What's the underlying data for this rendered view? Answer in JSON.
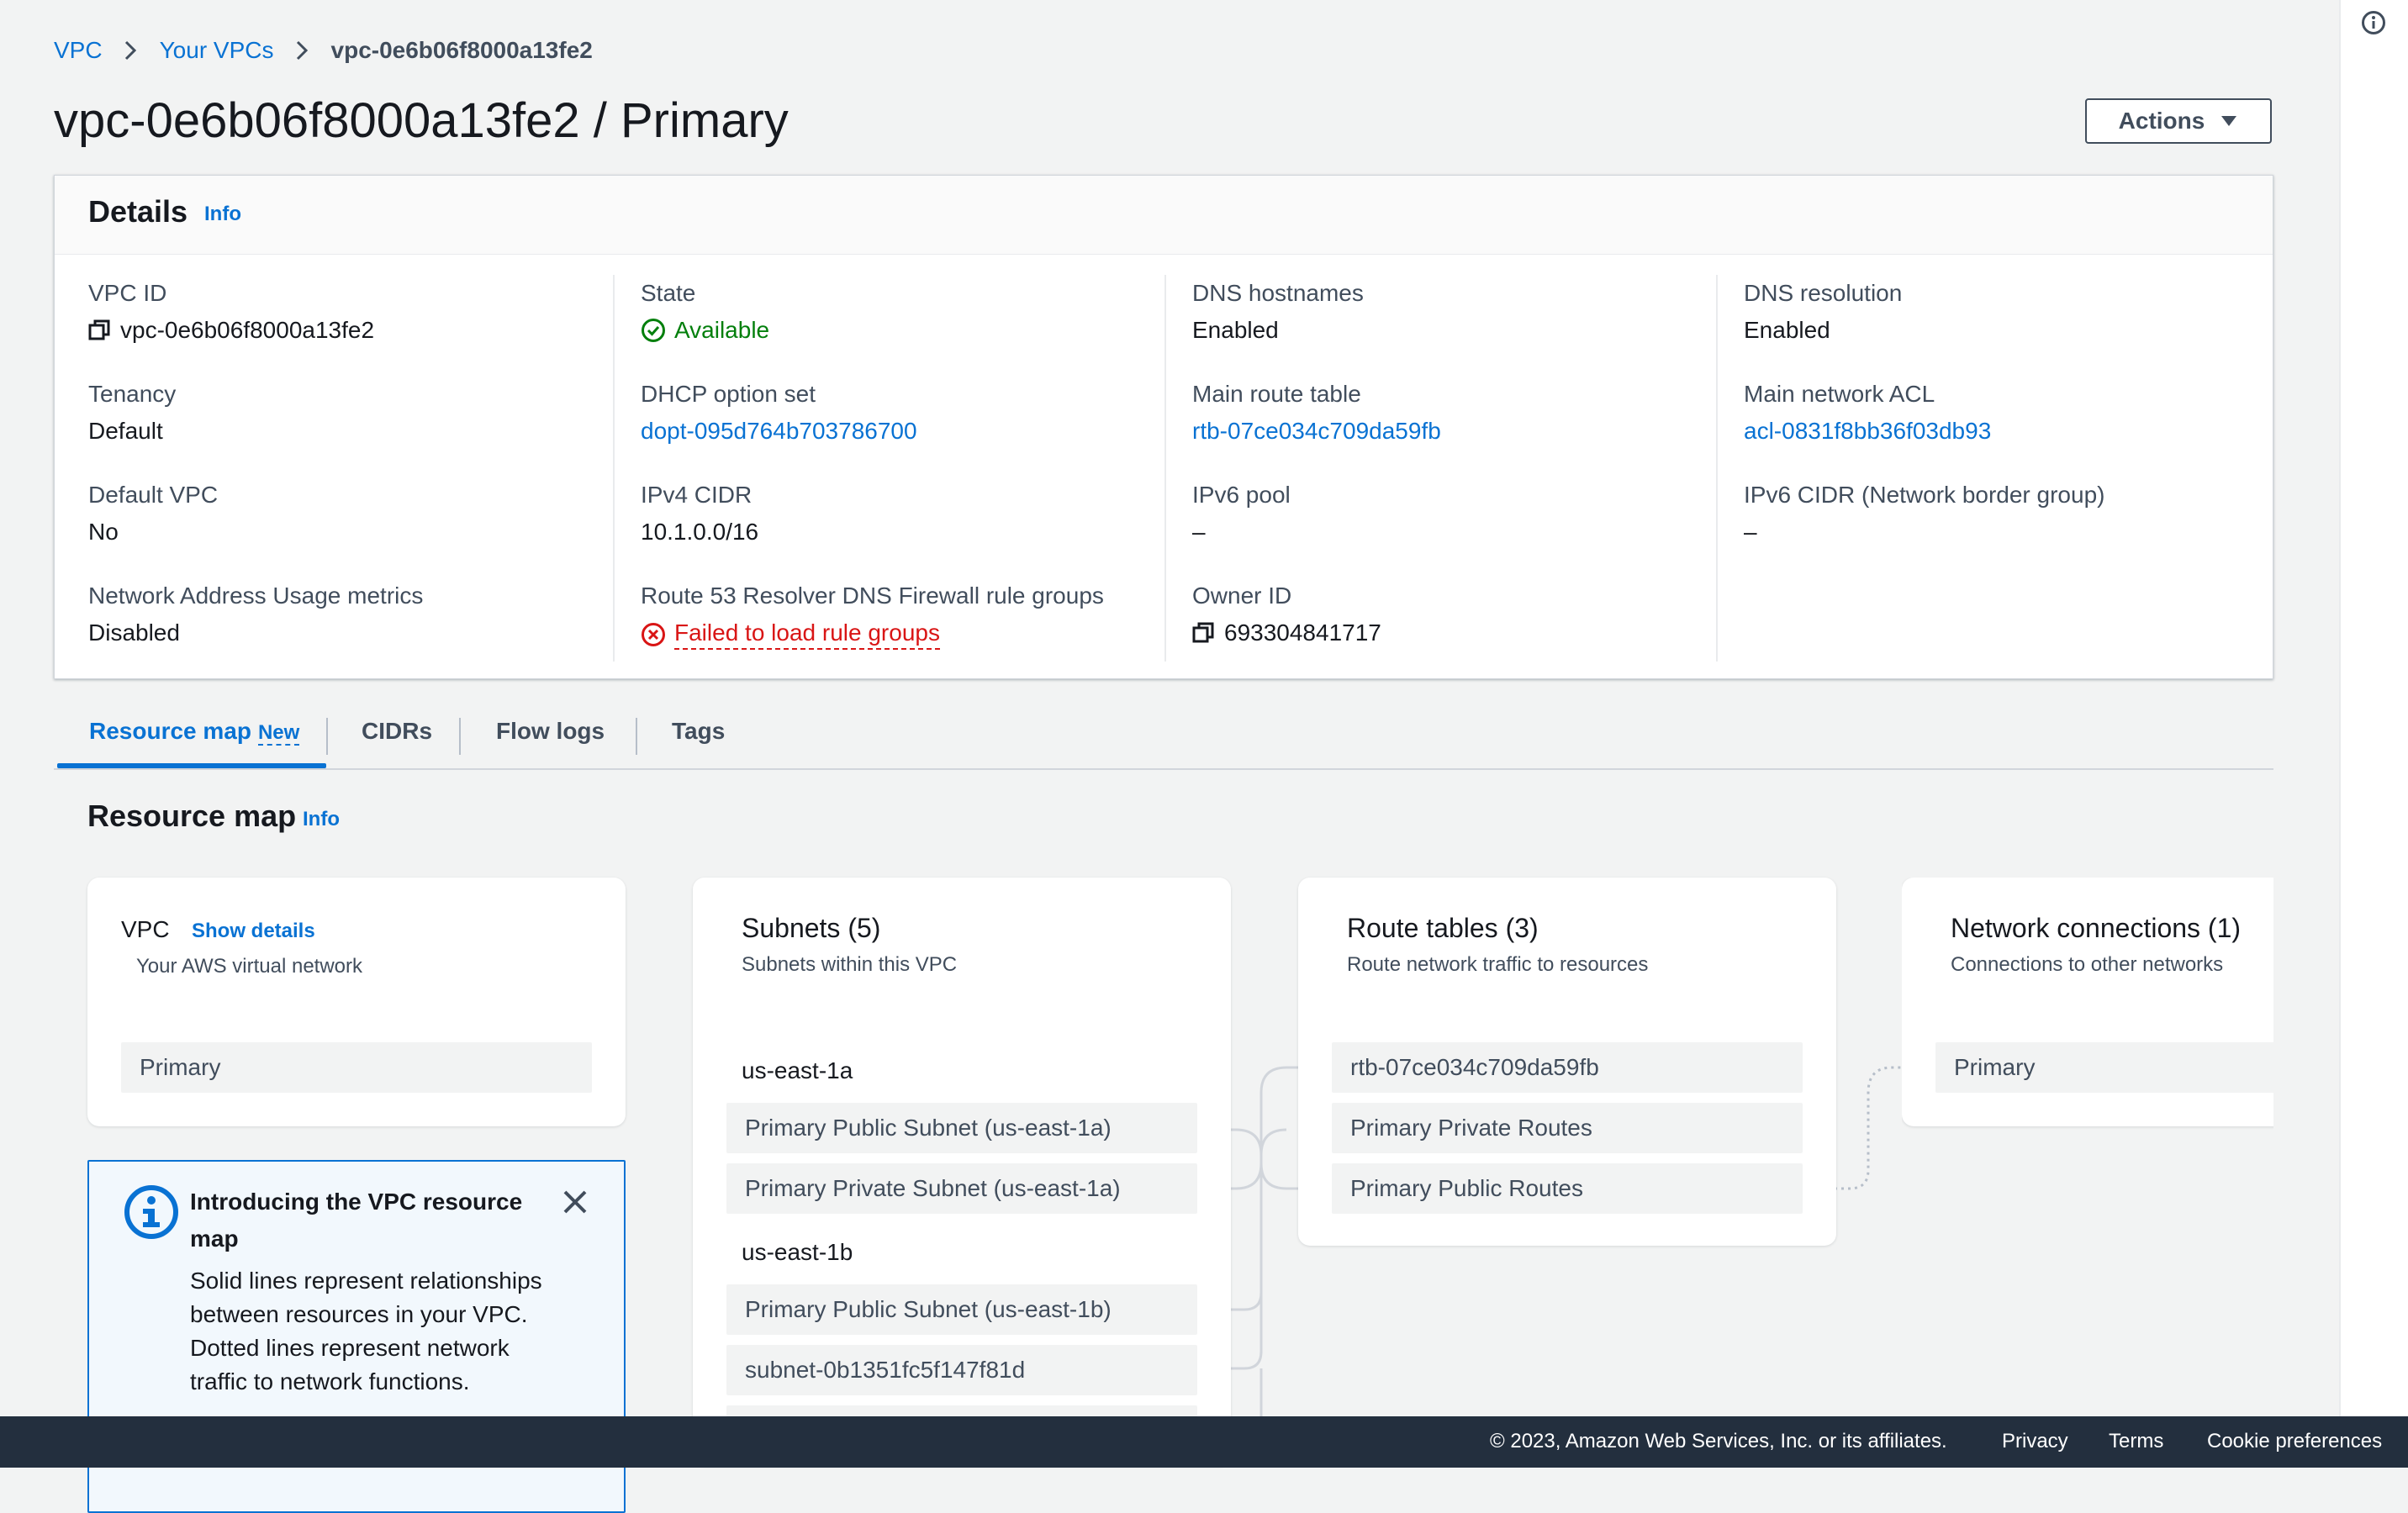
{
  "breadcrumb": {
    "items": [
      "VPC",
      "Your VPCs"
    ],
    "current": "vpc-0e6b06f8000a13fe2"
  },
  "page": {
    "title": "vpc-0e6b06f8000a13fe2 / Primary",
    "actions_label": "Actions"
  },
  "details": {
    "title": "Details",
    "info": "Info",
    "fields": {
      "vpc_id": {
        "label": "VPC ID",
        "value": "vpc-0e6b06f8000a13fe2"
      },
      "state": {
        "label": "State",
        "value": "Available"
      },
      "dns_hostnames": {
        "label": "DNS hostnames",
        "value": "Enabled"
      },
      "dns_resolution": {
        "label": "DNS resolution",
        "value": "Enabled"
      },
      "tenancy": {
        "label": "Tenancy",
        "value": "Default"
      },
      "dhcp": {
        "label": "DHCP option set",
        "value": "dopt-095d764b703786700"
      },
      "main_route_table": {
        "label": "Main route table",
        "value": "rtb-07ce034c709da59fb"
      },
      "main_acl": {
        "label": "Main network ACL",
        "value": "acl-0831f8bb36f03db93"
      },
      "default_vpc": {
        "label": "Default VPC",
        "value": "No"
      },
      "ipv4_cidr": {
        "label": "IPv4 CIDR",
        "value": "10.1.0.0/16"
      },
      "ipv6_pool": {
        "label": "IPv6 pool",
        "value": "–"
      },
      "ipv6_cidr": {
        "label": "IPv6 CIDR (Network border group)",
        "value": "–"
      },
      "nau_metrics": {
        "label": "Network Address Usage metrics",
        "value": "Disabled"
      },
      "route53": {
        "label": "Route 53 Resolver DNS Firewall rule groups",
        "value": "Failed to load rule groups"
      },
      "owner_id": {
        "label": "Owner ID",
        "value": "693304841717"
      }
    }
  },
  "tabs": [
    {
      "label": "Resource map",
      "badge": "New",
      "active": true
    },
    {
      "label": "CIDRs"
    },
    {
      "label": "Flow logs"
    },
    {
      "label": "Tags"
    }
  ],
  "resource_map": {
    "title": "Resource map",
    "info": "Info",
    "vpc": {
      "title": "VPC",
      "show_details": "Show details",
      "subtitle": "Your AWS virtual network",
      "item": "Primary"
    },
    "subnets": {
      "title": "Subnets (5)",
      "subtitle": "Subnets within this VPC",
      "groups": [
        {
          "az": "us-east-1a",
          "items": [
            "Primary Public Subnet (us-east-1a)",
            "Primary Private Subnet (us-east-1a)"
          ]
        },
        {
          "az": "us-east-1b",
          "items": [
            "Primary Public Subnet (us-east-1b)",
            "subnet-0b1351fc5f147f81d"
          ]
        }
      ]
    },
    "route_tables": {
      "title": "Route tables (3)",
      "subtitle": "Route network traffic to resources",
      "items": [
        "rtb-07ce034c709da59fb",
        "Primary Private Routes",
        "Primary Public Routes"
      ]
    },
    "network_connections": {
      "title": "Network connections (1)",
      "subtitle": "Connections to other networks",
      "items": [
        "Primary"
      ]
    },
    "intro": {
      "title": "Introducing the VPC resource map",
      "body": "Solid lines represent relationships between resources in your VPC. Dotted lines represent network traffic to network functions."
    }
  },
  "footer": {
    "copyright": "© 2023, Amazon Web Services, Inc. or its affiliates.",
    "privacy": "Privacy",
    "terms": "Terms",
    "cookies": "Cookie preferences"
  },
  "colors": {
    "link": "#0972d3",
    "success": "#037f0c",
    "error": "#d91515",
    "footer_bg": "#232f3e"
  }
}
